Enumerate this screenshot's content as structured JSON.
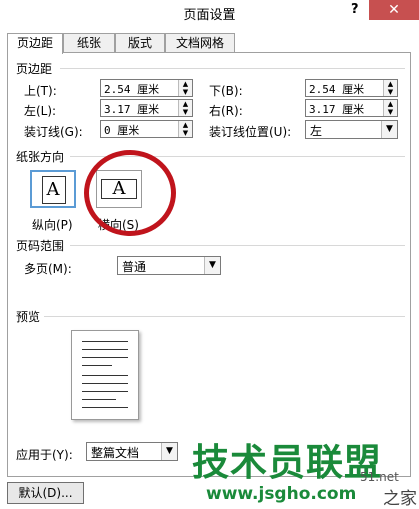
{
  "window": {
    "title": "页面设置",
    "help": "?",
    "close": "✕"
  },
  "tabs": [
    {
      "label": "页边距"
    },
    {
      "label": "纸张"
    },
    {
      "label": "版式"
    },
    {
      "label": "文档网格"
    }
  ],
  "margins": {
    "section": "页边距",
    "top_label": "上(T):",
    "top_value": "2.54 厘米",
    "bottom_label": "下(B):",
    "bottom_value": "2.54 厘米",
    "left_label": "左(L):",
    "left_value": "3.17 厘米",
    "right_label": "右(R):",
    "right_value": "3.17 厘米",
    "gutter_label": "装订线(G):",
    "gutter_value": "0 厘米",
    "gutter_pos_label": "装订线位置(U):",
    "gutter_pos_value": "左"
  },
  "orientation": {
    "section": "纸张方向",
    "portrait_label": "纵向(P)",
    "portrait_glyph": "A",
    "landscape_label": "横向(S)",
    "landscape_glyph": "A",
    "selected": "portrait"
  },
  "pages": {
    "section": "页码范围",
    "multi_label": "多页(M):",
    "multi_value": "普通"
  },
  "preview": {
    "section": "预览"
  },
  "apply": {
    "label": "应用于(Y):",
    "value": "整篇文档"
  },
  "buttons": {
    "default": "默认(D)..."
  },
  "watermark": {
    "main": "技术员联盟",
    "url": "www.jsgho.com",
    "side": "51.net",
    "side2": "之家"
  },
  "colors": {
    "accent": "#5b9bd5",
    "circle": "#c0141c",
    "watermark": "#1a8a3a"
  }
}
